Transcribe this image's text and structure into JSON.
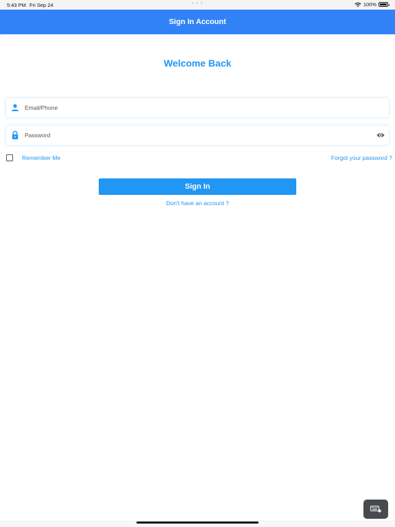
{
  "status_bar": {
    "time": "5:43 PM",
    "date": "Fri Sep 24",
    "battery": "100%",
    "battery_level_percent": 100
  },
  "header": {
    "title": "Sign In Account"
  },
  "login": {
    "welcome": "Welcome Back",
    "email_placeholder": "Email/Phone",
    "email_value": "",
    "password_placeholder": "Password",
    "password_value": "",
    "remember_label": "Remember Me",
    "remember_checked": false,
    "forgot_label": "Forgot your password ?",
    "signin_label": "Sign In",
    "signup_label": "Don't have an account ?"
  },
  "icons": {
    "user": "user-icon",
    "lock": "lock-icon",
    "eye": "eye-icon",
    "keyboard": "keyboard-icon",
    "wifi": "wifi-icon",
    "battery": "battery-icon"
  },
  "colors": {
    "header_bg": "#3282f7",
    "accent": "#2196f3",
    "text": "#333333"
  }
}
